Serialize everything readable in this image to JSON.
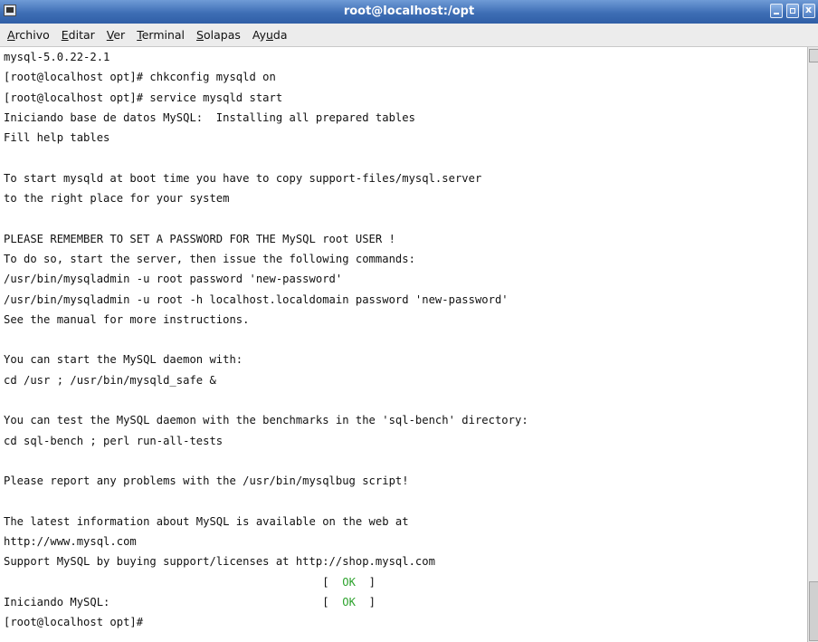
{
  "window": {
    "title": "root@localhost:/opt"
  },
  "menu": [
    {
      "pre": "",
      "key": "A",
      "post": "rchivo"
    },
    {
      "pre": "",
      "key": "E",
      "post": "ditar"
    },
    {
      "pre": "",
      "key": "V",
      "post": "er"
    },
    {
      "pre": "",
      "key": "T",
      "post": "erminal"
    },
    {
      "pre": "",
      "key": "S",
      "post": "olapas"
    },
    {
      "pre": "Ay",
      "key": "u",
      "post": "da"
    }
  ],
  "terminal": {
    "lines": [
      "mysql-5.0.22-2.1",
      "[root@localhost opt]# chkconfig mysqld on",
      "[root@localhost opt]# service mysqld start",
      "Iniciando base de datos MySQL:  Installing all prepared tables",
      "Fill help tables",
      "",
      "To start mysqld at boot time you have to copy support-files/mysql.server",
      "to the right place for your system",
      "",
      "PLEASE REMEMBER TO SET A PASSWORD FOR THE MySQL root USER !",
      "To do so, start the server, then issue the following commands:",
      "/usr/bin/mysqladmin -u root password 'new-password'",
      "/usr/bin/mysqladmin -u root -h localhost.localdomain password 'new-password'",
      "See the manual for more instructions.",
      "",
      "You can start the MySQL daemon with:",
      "cd /usr ; /usr/bin/mysqld_safe &",
      "",
      "You can test the MySQL daemon with the benchmarks in the 'sql-bench' directory:",
      "cd sql-bench ; perl run-all-tests",
      "",
      "Please report any problems with the /usr/bin/mysqlbug script!",
      "",
      "The latest information about MySQL is available on the web at",
      "http://www.mysql.com",
      "Support MySQL by buying support/licenses at http://shop.mysql.com"
    ],
    "status1": {
      "label": "",
      "open": "[",
      "ok": "OK",
      "close": "]"
    },
    "status2": {
      "label": "Iniciando MySQL:",
      "open": "[",
      "ok": "OK",
      "close": "]"
    },
    "prompt": "[root@localhost opt]#",
    "ok_color": "#2ea32e"
  }
}
